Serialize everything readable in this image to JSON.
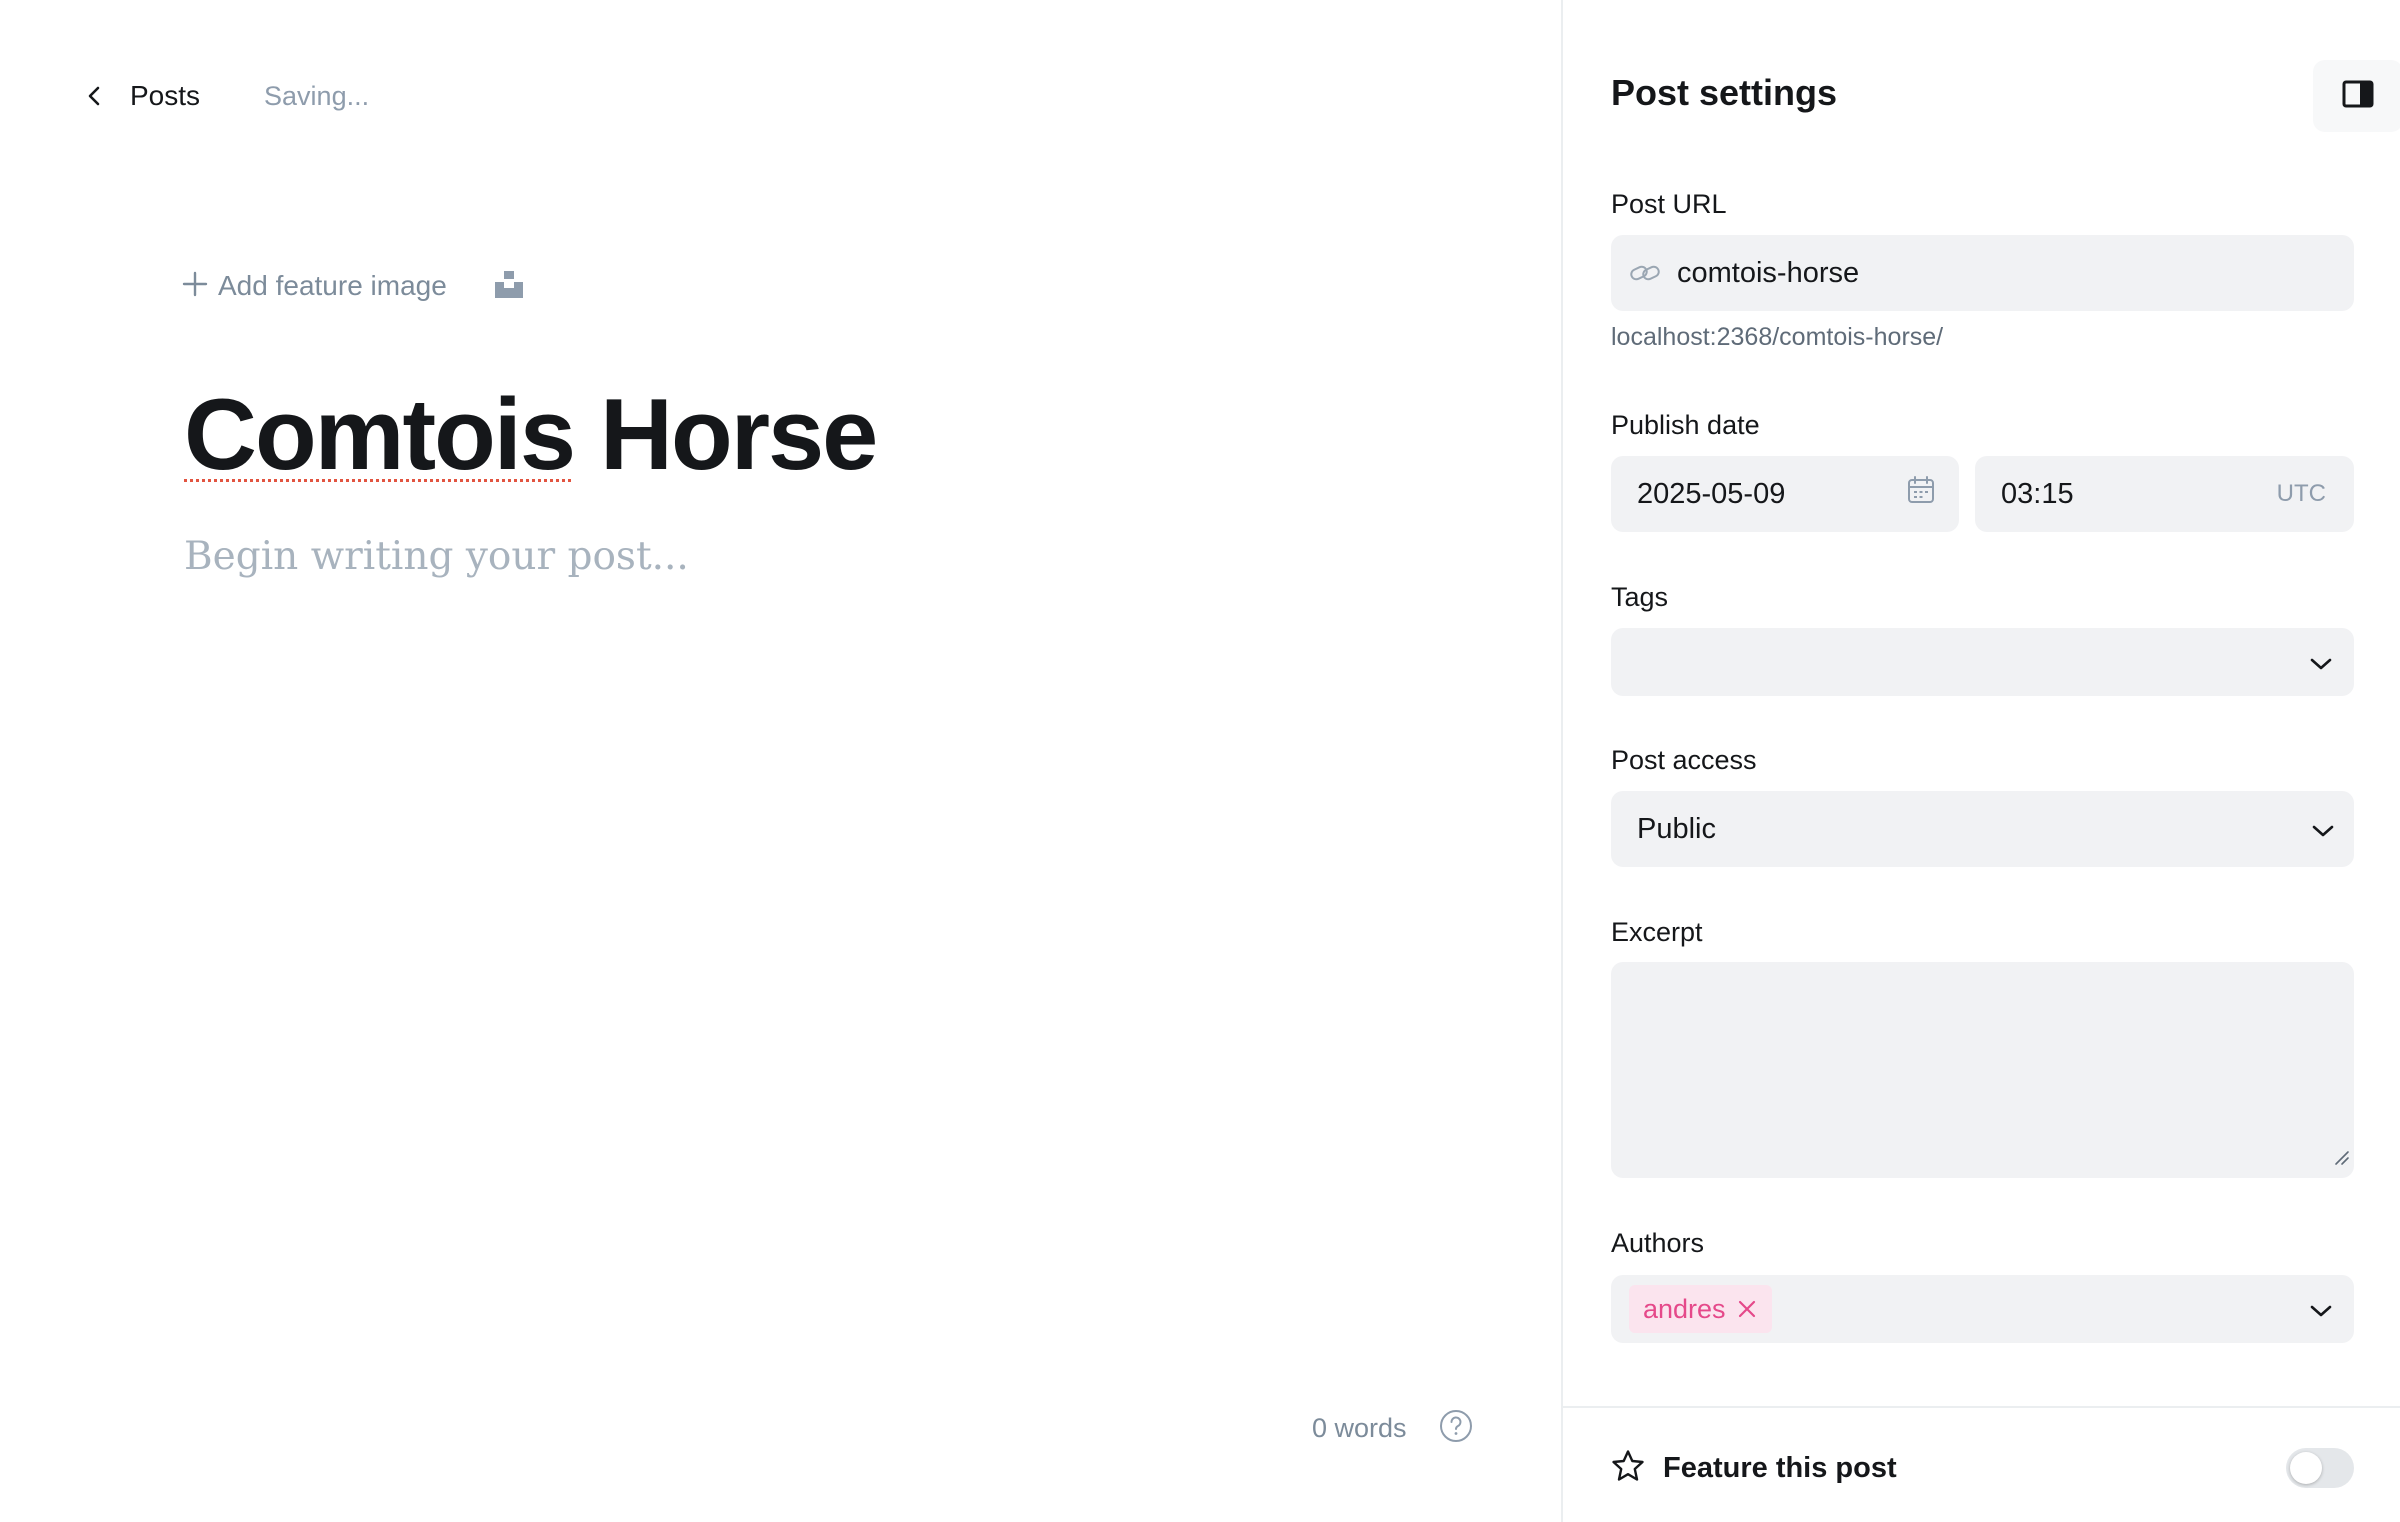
{
  "editor": {
    "back_label": "Posts",
    "save_status": "Saving...",
    "add_feature_image_label": "Add feature image",
    "title_misspelled": "Comtois",
    "title_rest": " Horse",
    "body_placeholder": "Begin writing your post...",
    "word_count": "0 words"
  },
  "settings": {
    "title": "Post settings",
    "post_url": {
      "label": "Post URL",
      "value": "comtois-horse",
      "hint": "localhost:2368/comtois-horse/"
    },
    "publish_date": {
      "label": "Publish date",
      "date": "2025-05-09",
      "time": "03:15",
      "timezone": "UTC"
    },
    "tags": {
      "label": "Tags",
      "value": ""
    },
    "post_access": {
      "label": "Post access",
      "value": "Public"
    },
    "excerpt": {
      "label": "Excerpt",
      "value": ""
    },
    "authors": {
      "label": "Authors",
      "items": [
        "andres"
      ]
    },
    "feature_post": {
      "label": "Feature this post",
      "enabled": false
    }
  },
  "colors": {
    "accent_pink": "#e5498a",
    "input_bg": "#f1f2f4",
    "muted_text": "#8e9cac"
  },
  "icons": [
    "chevron-left-icon",
    "plus-icon",
    "unsplash-icon",
    "help-circle-icon",
    "sidebar-panel-icon",
    "link-icon",
    "calendar-icon",
    "chevron-down-icon",
    "close-icon",
    "star-icon",
    "resize-grip-icon"
  ]
}
